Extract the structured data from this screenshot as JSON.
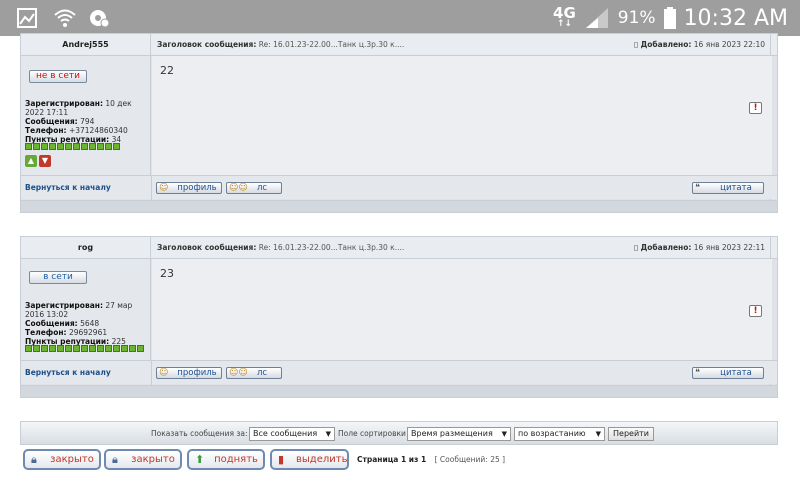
{
  "status_bar": {
    "network": "4G",
    "network_sub": "↑↓",
    "battery": "91%",
    "time": "10:32 AM"
  },
  "posts": [
    {
      "author": "Andrej555",
      "subject_label": "Заголовок сообщения:",
      "subject": "Re: 16.01.23-22.00...Танк ц.3р.30 к....",
      "posted_label": "Добавлено:",
      "posted": "16 янв 2023 22:10",
      "online_status": "не в сети",
      "registered_label": "Зарегистрирован:",
      "registered": "10 дек 2022 17:11",
      "messages_label": "Сообщения:",
      "messages": "794",
      "phone_label": "Телефон:",
      "phone": "+37124860340",
      "rep_label": "Пункты репутации:",
      "rep": "34",
      "body": "22",
      "back_link": "Вернуться к началу",
      "profile_btn": "профиль",
      "pm_btn": "лс",
      "quote_btn": "цитата"
    },
    {
      "author": "rog",
      "subject_label": "Заголовок сообщения:",
      "subject": "Re: 16.01.23-22.00...Танк ц.3р.30 к....",
      "posted_label": "Добавлено:",
      "posted": "16 янв 2023 22:11",
      "online_status": "в сети",
      "registered_label": "Зарегистрирован:",
      "registered": "27 мар 2016 13:02",
      "messages_label": "Сообщения:",
      "messages": "5648",
      "phone_label": "Телефон:",
      "phone": "29692961",
      "rep_label": "Пункты репутации:",
      "rep": "225",
      "body": "23",
      "back_link": "Вернуться к началу",
      "profile_btn": "профиль",
      "pm_btn": "лс",
      "quote_btn": "цитата"
    }
  ],
  "sort_bar": {
    "show_label": "Показать сообщения за:",
    "show_value": "Все сообщения",
    "sort_label": "Поле сортировки",
    "sort_value": "Время размещения",
    "order_value": "по возрастанию",
    "go_label": "Перейти"
  },
  "actions": {
    "locked1": "закрыто",
    "locked2": "закрыто",
    "bump": "поднять",
    "select": "выделить"
  },
  "pagination": {
    "page_text": "Страница 1 из 1",
    "count_text": "[ Сообщений: 25 ]"
  }
}
